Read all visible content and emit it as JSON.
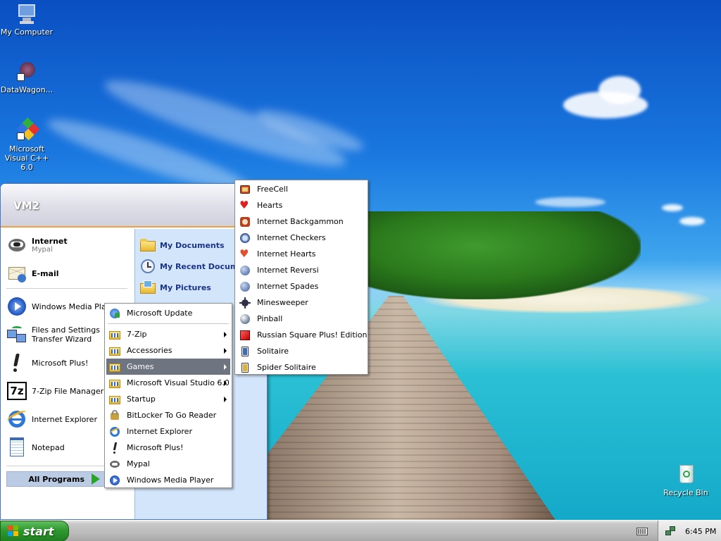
{
  "desktop": {
    "icons": [
      {
        "label": "My Computer",
        "icon": "computer-icon"
      },
      {
        "label": "DataWagon...",
        "icon": "datawagon-shortcut-icon"
      },
      {
        "label": "Microsoft Visual C++ 6.0",
        "icon": "visual-cpp-shortcut-icon"
      },
      {
        "label": "Recycle Bin",
        "icon": "recycle-bin-icon"
      }
    ]
  },
  "start_menu": {
    "user_name": "VM2",
    "pinned": [
      {
        "label": "Internet",
        "sublabel": "Mypal",
        "icon": "mypal-icon"
      },
      {
        "label": "E-mail",
        "icon": "email-icon"
      }
    ],
    "recent": [
      {
        "label": "Windows Media Player",
        "icon": "media-player-icon"
      },
      {
        "label": "Files and Settings Transfer Wizard",
        "icon": "transfer-wizard-icon"
      },
      {
        "label": "Microsoft Plus!",
        "icon": "plus-icon"
      },
      {
        "label": "7-Zip File Manager",
        "icon": "7zip-icon"
      },
      {
        "label": "Internet Explorer",
        "icon": "ie-icon"
      },
      {
        "label": "Notepad",
        "icon": "notepad-icon"
      }
    ],
    "all_programs_label": "All Programs",
    "right": [
      {
        "label": "My Documents",
        "icon": "folder-icon"
      },
      {
        "label": "My Recent Documents",
        "icon": "recent-docs-icon"
      },
      {
        "label": "My Pictures",
        "icon": "pictures-folder-icon"
      }
    ]
  },
  "programs_menu": {
    "items": [
      {
        "label": "Microsoft Update",
        "icon": "update-icon",
        "submenu": false
      },
      {
        "label": "7-Zip",
        "icon": "program-group-icon",
        "submenu": true
      },
      {
        "label": "Accessories",
        "icon": "program-group-icon",
        "submenu": true
      },
      {
        "label": "Games",
        "icon": "program-group-icon",
        "submenu": true,
        "highlighted": true
      },
      {
        "label": "Microsoft Visual Studio 6.0",
        "icon": "program-group-icon",
        "submenu": true
      },
      {
        "label": "Startup",
        "icon": "program-group-icon",
        "submenu": true
      },
      {
        "label": "BitLocker To Go Reader",
        "icon": "bitlocker-icon",
        "submenu": false
      },
      {
        "label": "Internet Explorer",
        "icon": "ie-icon",
        "submenu": false
      },
      {
        "label": "Microsoft Plus!",
        "icon": "plus-icon",
        "submenu": false
      },
      {
        "label": "Mypal",
        "icon": "mypal-icon",
        "submenu": false
      },
      {
        "label": "Windows Media Player",
        "icon": "media-player-icon",
        "submenu": false
      }
    ]
  },
  "games_menu": {
    "items": [
      {
        "label": "FreeCell",
        "icon": "freecell-icon"
      },
      {
        "label": "Hearts",
        "icon": "hearts-icon"
      },
      {
        "label": "Internet Backgammon",
        "icon": "backgammon-icon"
      },
      {
        "label": "Internet Checkers",
        "icon": "checkers-icon"
      },
      {
        "label": "Internet Hearts",
        "icon": "internet-hearts-icon"
      },
      {
        "label": "Internet Reversi",
        "icon": "reversi-icon"
      },
      {
        "label": "Internet Spades",
        "icon": "spades-icon"
      },
      {
        "label": "Minesweeper",
        "icon": "minesweeper-icon"
      },
      {
        "label": "Pinball",
        "icon": "pinball-icon"
      },
      {
        "label": "Russian Square Plus! Edition",
        "icon": "russian-square-icon"
      },
      {
        "label": "Solitaire",
        "icon": "solitaire-icon"
      },
      {
        "label": "Spider Solitaire",
        "icon": "spider-solitaire-icon"
      }
    ]
  },
  "taskbar": {
    "start_label": "start",
    "clock": "6:45 PM"
  },
  "colors": {
    "start_green": "#2f9a2f",
    "menu_highlight": "#6e7581",
    "places_blue": "#1b3588"
  }
}
